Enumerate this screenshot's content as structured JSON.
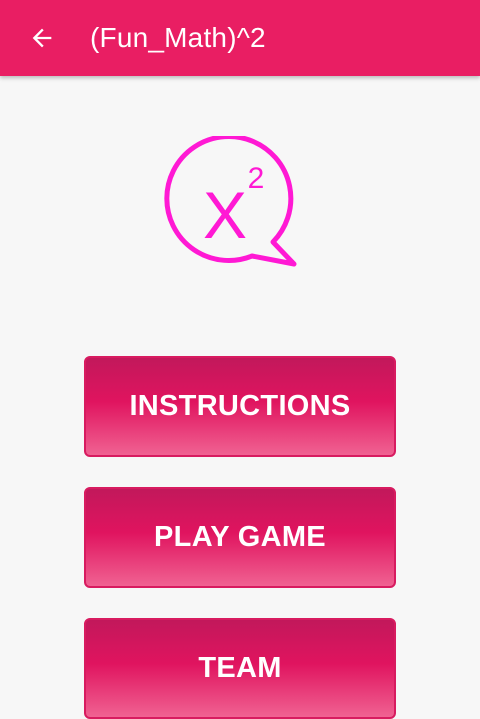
{
  "app_bar": {
    "title": "(Fun_Math)^2",
    "back_icon": "arrow-left-icon",
    "color": "#e91e63"
  },
  "logo": {
    "base": "X",
    "exponent": "2",
    "icon": "speech-bubble-icon",
    "color": "#ff19d4"
  },
  "menu": {
    "buttons": [
      {
        "label": "INSTRUCTIONS"
      },
      {
        "label": "PLAY GAME"
      },
      {
        "label": "TEAM"
      }
    ]
  }
}
